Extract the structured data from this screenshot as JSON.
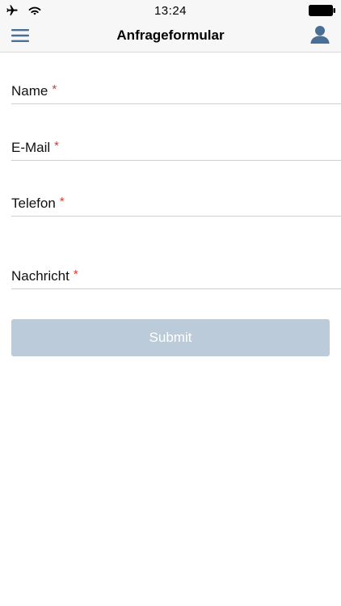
{
  "status_bar": {
    "time": "13:24",
    "icons": [
      "airplane-icon",
      "wifi-icon",
      "battery-icon"
    ]
  },
  "nav": {
    "title": "Anfrageformular",
    "menu_icon": "hamburger-menu-icon",
    "profile_icon": "user-profile-icon",
    "icon_color": "#4a6f96"
  },
  "form": {
    "fields": [
      {
        "label": "Name",
        "required_mark": "*"
      },
      {
        "label": "E-Mail",
        "required_mark": "*"
      },
      {
        "label": "Telefon",
        "required_mark": "*"
      },
      {
        "label": "Nachricht",
        "required_mark": "*"
      }
    ],
    "submit_label": "Submit",
    "required_color": "#e0352b",
    "submit_color": "#bccbd9"
  }
}
